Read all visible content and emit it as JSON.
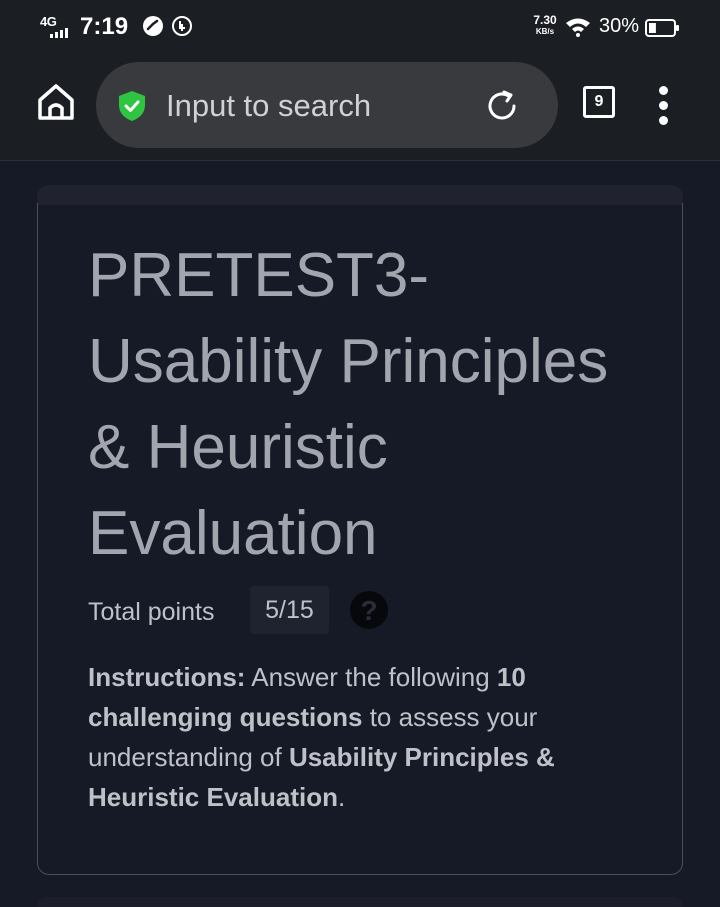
{
  "status_bar": {
    "network": "4G",
    "time": "7:19",
    "speed_value": "7.30",
    "speed_unit": "KB/s",
    "battery_percent": "30%",
    "battery_level": 0.3
  },
  "toolbar": {
    "search_placeholder": "Input to search",
    "tab_count": "9"
  },
  "quiz": {
    "title_line1": "PRETEST3-",
    "title_line2": "Usability Principles",
    "title_line3": "& Heuristic",
    "title_line4": "Evaluation",
    "points_label": "Total points",
    "points_value": "5/15",
    "help_symbol": "?",
    "instructions": {
      "label": "Instructions:",
      "t1": " Answer the following ",
      "b1": "10 challenging questions",
      "t2": " to assess your understanding of ",
      "b2": "Usability Principles & Heuristic Evaluation",
      "t3": "."
    }
  },
  "colors": {
    "background": "#161a26",
    "toolbar": "#1b1e22",
    "search_pill": "#383a3d",
    "shield": "#2fc441",
    "title_text": "#a2a5ae",
    "card_border": "#4a4e59"
  }
}
